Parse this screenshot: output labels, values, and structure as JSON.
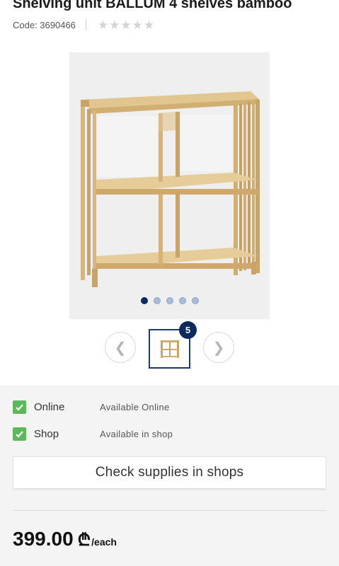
{
  "product": {
    "title": "Shelving unit BALLUM 4 shelves bamboo",
    "code": "Code: 3690466",
    "rating": 0,
    "rating_max": 5
  },
  "gallery": {
    "image": "bamboo-shelving-unit",
    "image_count": 5,
    "active_index": 0,
    "thumbnail_badge": "5"
  },
  "availability": {
    "items": [
      {
        "label": "Online",
        "status": "Available Online",
        "checked": true
      },
      {
        "label": "Shop",
        "status": "Available in shop",
        "checked": true
      }
    ],
    "check_button": "Check supplies in shops"
  },
  "price": {
    "amount": "399.00",
    "currency_symbol": "₾",
    "unit": "/each"
  },
  "colors": {
    "accent_navy": "#0d2a5c",
    "check_green": "#5cb85c"
  }
}
